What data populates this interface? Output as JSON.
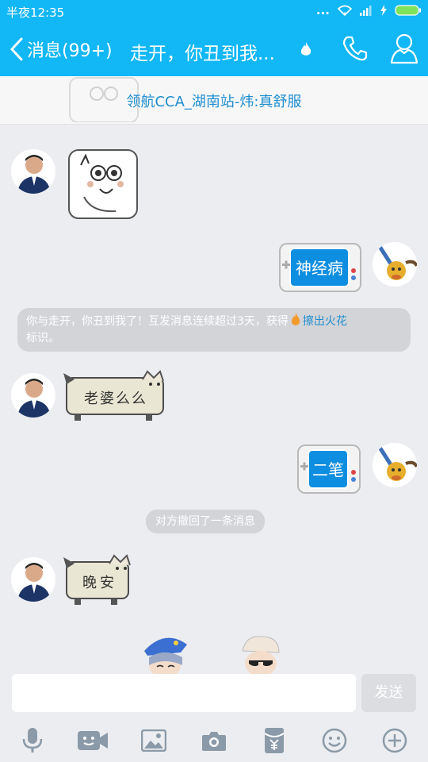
{
  "status_bar": {
    "time": "半夜12:35",
    "dots": "..."
  },
  "header": {
    "back_label": "消息(99+)",
    "title": "走开，你丑到我..."
  },
  "banner": {
    "text": "领航CCA_湖南站-炜:真舒服"
  },
  "messages": {
    "sticker_nerve": "神经病",
    "sticker_wife": "老婆么么",
    "system_spark_text": "你与走开，你丑到我了！互发消息连续超过3天，获得",
    "system_spark_link": "擦出火花",
    "system_spark_suffix": "标识。",
    "sticker_erbi": "二笔",
    "system_recall": "对方撤回了一条消息",
    "sticker_night": "晚安"
  },
  "composer": {
    "input_value": "",
    "send_label": "发送"
  },
  "colors": {
    "brand_blue": "#12b7f5",
    "link_blue": "#1f8ecf",
    "bg": "#ecedf1"
  },
  "toolbar_icons": [
    "microphone-icon",
    "video-icon",
    "image-icon",
    "camera-icon",
    "red-packet-icon",
    "emoji-icon",
    "plus-icon"
  ]
}
